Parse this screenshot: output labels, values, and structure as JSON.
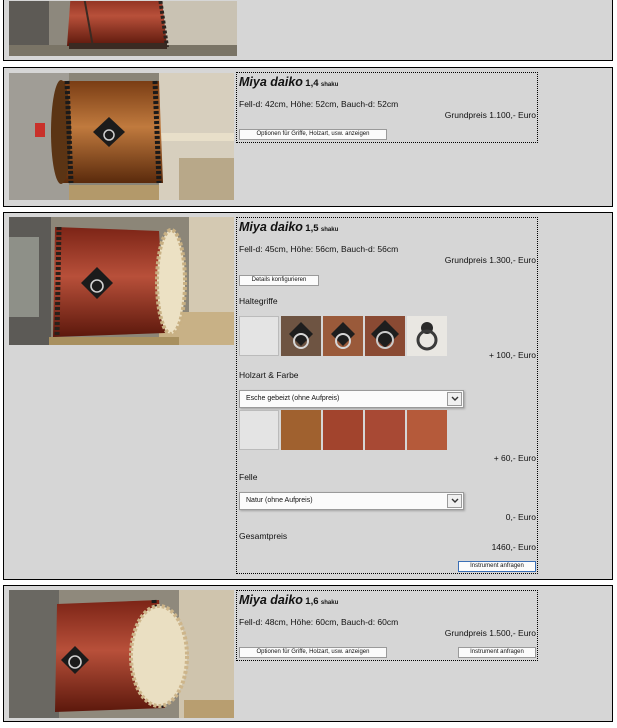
{
  "colors": {
    "panel_bg": "#d6d6d6",
    "border": "#000000",
    "button_bg": "#fbfbfb"
  },
  "products": [
    {
      "dimensions": ""
    },
    {
      "name": "Miya daiko",
      "size": "1,4",
      "unit": "shaku",
      "dimensions": "Fell-d: 42cm, Höhe: 52cm, Bauch-d: 52cm",
      "base_price": "Grundpreis 1.100,- Euro",
      "options_button": "Optionen für Griffe, Holzart, usw. anzeigen"
    },
    {
      "name": "Miya daiko",
      "size": "1,5",
      "unit": "shaku",
      "dimensions": "Fell-d: 45cm, Höhe: 56cm, Bauch-d: 56cm",
      "base_price": "Grundpreis 1.300,- Euro",
      "details_button": "Details konfigurieren",
      "handles": {
        "label": "Haltegriffe",
        "price": "+ 100,- Euro",
        "icons": [
          "blank-icon",
          "ring-handle-icon",
          "ring-handle-icon",
          "ring-handle-icon",
          "ornate-ring-handle-icon"
        ]
      },
      "wood": {
        "label": "Holzart & Farbe",
        "selected": "Esche gebeizt (ohne Aufpreis)",
        "price": "+ 60,- Euro",
        "swatches": [
          "#ffffff",
          "#a0612f",
          "#a2442d",
          "#a84934",
          "#b55a3a"
        ]
      },
      "skins": {
        "label": "Felle",
        "selected": "Natur (ohne Aufpreis)",
        "price": "0,- Euro"
      },
      "total": {
        "label": "Gesamtpreis",
        "value": "1460,- Euro"
      },
      "request_button": "Instrument anfragen"
    },
    {
      "name": "Miya daiko",
      "size": "1,6",
      "unit": "shaku",
      "dimensions": "Fell-d: 48cm, Höhe: 60cm, Bauch-d: 60cm",
      "base_price": "Grundpreis 1.500,- Euro",
      "options_button": "Optionen für Griffe, Holzart, usw. anzeigen",
      "request_button": "Instrument anfragen"
    }
  ]
}
